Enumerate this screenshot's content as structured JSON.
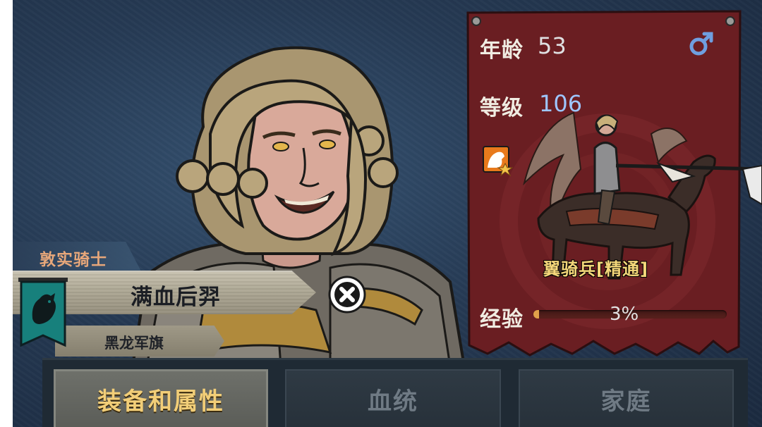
{
  "character": {
    "title": "敦实骑士",
    "name": "满血后羿",
    "faction": "黑龙军旗"
  },
  "stats": {
    "age_label": "年龄",
    "age_value": "53",
    "gender_icon": "male-symbol-icon",
    "level_label": "等级",
    "level_value": "106",
    "unit_name": "翼骑兵[精通]",
    "exp_label": "经验",
    "exp_text": "3%",
    "exp_progress": 0.03
  },
  "tabs": [
    {
      "label": "装备和属性",
      "active": true
    },
    {
      "label": "血统",
      "active": false
    },
    {
      "label": "家庭",
      "active": false
    }
  ],
  "colors": {
    "background": "#263a54",
    "panel": "#6b1f23",
    "level_value": "#9ec6ff",
    "unit_name": "#f4d77a",
    "title": "#e7a77a",
    "active_tab_text": "#f2ce78",
    "inactive_tab_text": "#6f7a84"
  }
}
